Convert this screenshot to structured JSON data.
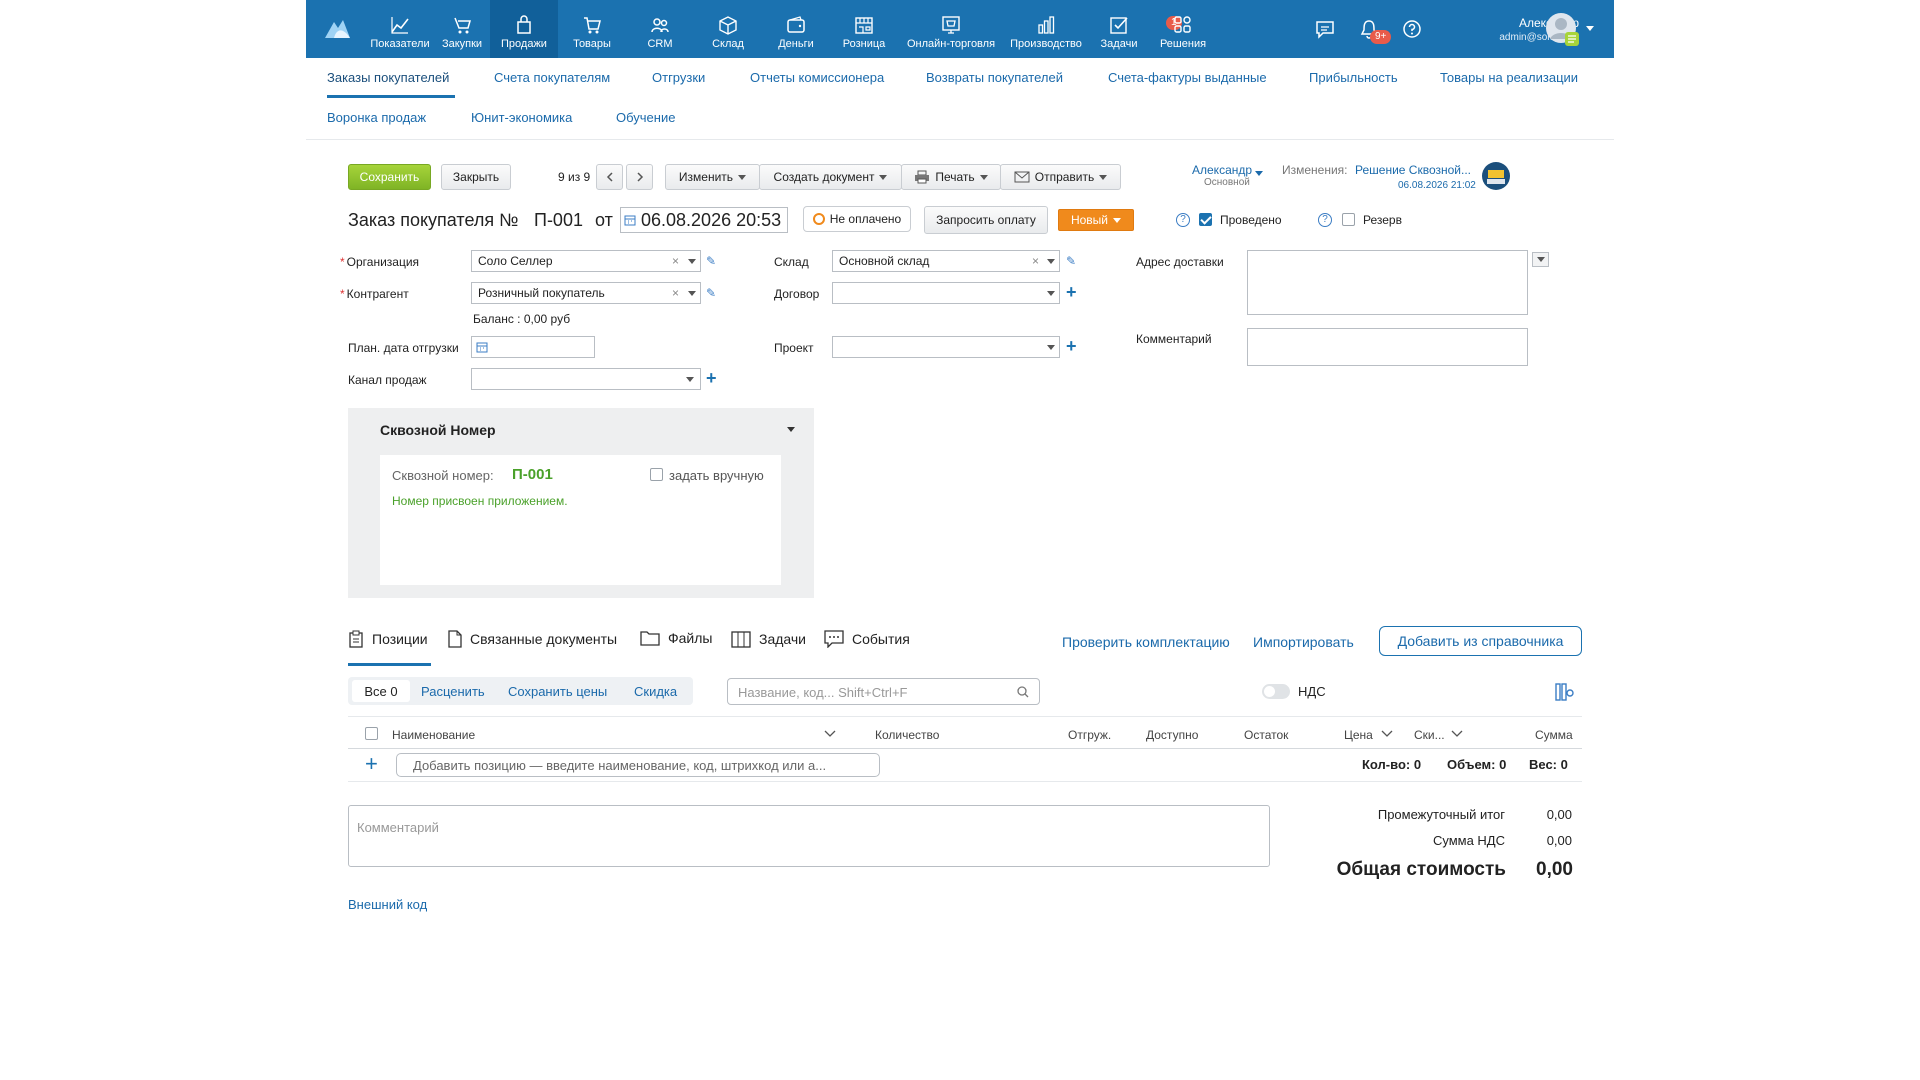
{
  "topnav": {
    "items": [
      {
        "label": "Показатели",
        "icon": "chart-line-icon"
      },
      {
        "label": "Закупки",
        "icon": "purchases-icon"
      },
      {
        "label": "Продажи",
        "icon": "shopping-bag-icon"
      },
      {
        "label": "Товары",
        "icon": "cart-icon"
      },
      {
        "label": "CRM",
        "icon": "users-icon"
      },
      {
        "label": "Склад",
        "icon": "box-icon"
      },
      {
        "label": "Деньги",
        "icon": "wallet-icon"
      },
      {
        "label": "Розница",
        "icon": "store-icon"
      },
      {
        "label": "Онлайн-торговля",
        "icon": "online-shop-icon"
      },
      {
        "label": "Производство",
        "icon": "bar-chart-icon"
      },
      {
        "label": "Задачи",
        "icon": "tasks-icon"
      },
      {
        "label": "Решения",
        "icon": "grid-icon"
      }
    ],
    "tasks_badge": "1",
    "notifications_badge": "9+",
    "user_name": "Александр",
    "user_email": "admin@soloseller"
  },
  "subnav": {
    "row1": [
      "Заказы покупателей",
      "Счета покупателям",
      "Отгрузки",
      "Отчеты комиссионера",
      "Возвраты покупателей",
      "Счета-фактуры выданные",
      "Прибыльность",
      "Товары на реализации"
    ],
    "row2": [
      "Воронка продаж",
      "Юнит-экономика",
      "Обучение"
    ]
  },
  "toolbar": {
    "save": "Сохранить",
    "close": "Закрыть",
    "pager": "9 из 9",
    "edit": "Изменить",
    "create_doc": "Создать документ",
    "print": "Печать",
    "send": "Отправить",
    "owner_name": "Александр",
    "owner_group": "Основной",
    "changes_label": "Изменения:",
    "changes_link": "Решение Сквозной...",
    "changes_date": "06.08.2026 21:02"
  },
  "header": {
    "title": "Заказ покупателя №",
    "number": "П-001",
    "from": "от",
    "date": "06.08.2026 20:53",
    "payment_status": "Не оплачено",
    "request_payment": "Запросить оплату",
    "status": "Новый",
    "posted_label": "Проведено",
    "reserve_label": "Резерв"
  },
  "form": {
    "organization_label": "Организация",
    "organization_value": "Соло Селлер",
    "counterparty_label": "Контрагент",
    "counterparty_value": "Розничный покупатель",
    "balance": "Баланс : 0,00 руб",
    "ship_date_label": "План. дата отгрузки",
    "sales_channel_label": "Канал продаж",
    "warehouse_label": "Склад",
    "warehouse_value": "Основной склад",
    "contract_label": "Договор",
    "project_label": "Проект",
    "delivery_address_label": "Адрес доставки",
    "comment_label": "Комментарий"
  },
  "skvoznoy": {
    "title": "Сквозной Номер",
    "number_label": "Сквозной номер:",
    "number_value": "П-001",
    "manual_label": "задать вручную",
    "note": "Номер присвоен приложением."
  },
  "tabs": {
    "positions": "Позиции",
    "linked_docs": "Связанные документы",
    "files": "Файлы",
    "tasks": "Задачи",
    "events": "События",
    "check_kit": "Проверить комплектацию",
    "import": "Импортировать",
    "add_from_catalog": "Добавить из справочника"
  },
  "filters": {
    "all": "Все 0",
    "price": "Расценить",
    "save_prices": "Сохранить цены",
    "discount": "Скидка",
    "search_placeholder": "Название, код... Shift+Ctrl+F",
    "vat": "НДС"
  },
  "table": {
    "columns": [
      "Наименование",
      "Количество",
      "Отгруж.",
      "Доступно",
      "Остаток",
      "Цена",
      "Ски...",
      "Сумма"
    ],
    "add_placeholder": "Добавить позицию — введите наименование, код, штрихкод или а...",
    "qty": "Кол-во: 0",
    "volume": "Объем: 0",
    "weight": "Вес: 0"
  },
  "totals": {
    "comment_placeholder": "Комментарий",
    "subtotal_label": "Промежуточный итог",
    "subtotal_value": "0,00",
    "vat_label": "Сумма НДС",
    "vat_value": "0,00",
    "total_label": "Общая стоимость",
    "total_value": "0,00",
    "external_code": "Внешний код"
  }
}
